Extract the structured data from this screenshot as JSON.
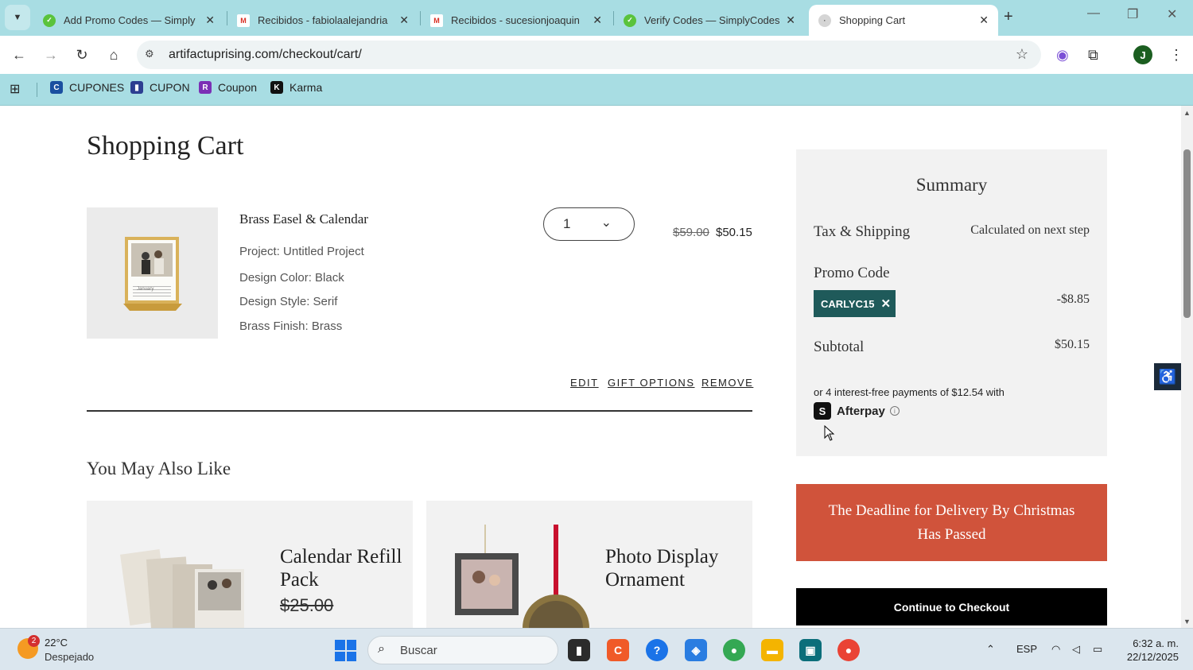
{
  "browser": {
    "tabs": [
      {
        "title": "Add Promo Codes — Simply",
        "active": false
      },
      {
        "title": "Recibidos - fabiolaalejandria",
        "active": false
      },
      {
        "title": "Recibidos - sucesionjoaquin",
        "active": false
      },
      {
        "title": "Verify Codes — SimplyCodes",
        "active": false
      },
      {
        "title": "Shopping Cart",
        "active": true
      }
    ],
    "url": "artifactuprising.com/checkout/cart/",
    "bookmarks": [
      {
        "label": "CUPONES",
        "icon": "cupones-icon"
      },
      {
        "label": "CUPON",
        "icon": "cupon-icon"
      },
      {
        "label": "Coupon",
        "icon": "coupon-icon"
      },
      {
        "label": "Karma",
        "icon": "karma-icon"
      }
    ],
    "profile_initial": "J"
  },
  "cart": {
    "title": "Shopping Cart",
    "item": {
      "name": "Brass Easel & Calendar",
      "project": "Project: Untitled Project",
      "design_color": "Design Color: Black",
      "design_style": "Design Style: Serif",
      "brass_finish": "Brass Finish: Brass",
      "quantity": "1",
      "price_original": "$59.00",
      "price_current": "$50.15",
      "image_caption": "January"
    },
    "actions": {
      "edit": "EDIT",
      "gift": "GIFT OPTIONS",
      "remove": "REMOVE"
    }
  },
  "recommendations": {
    "title": "You May Also Like",
    "items": [
      {
        "name": "Calendar Refill Pack",
        "price": "$25.00"
      },
      {
        "name": "Photo Display Ornament",
        "price": ""
      }
    ]
  },
  "summary": {
    "title": "Summary",
    "tax_label": "Tax & Shipping",
    "tax_value": "Calculated on next step",
    "promo_label": "Promo Code",
    "promo_code": "CARLYC15",
    "promo_discount": "-$8.85",
    "subtotal_label": "Subtotal",
    "subtotal_value": "$50.15",
    "afterpay_text": "or 4 interest-free payments of $12.54 with",
    "afterpay_brand": "Afterpay"
  },
  "deadline_notice": "The Deadline for Delivery By Christmas Has Passed",
  "checkout_label": "Continue to Checkout",
  "taskbar": {
    "weather_temp": "22°C",
    "weather_desc": "Despejado",
    "weather_badge": "2",
    "search_placeholder": "Buscar",
    "language": "ESP",
    "time": "6:32 a. m.",
    "date": "22/12/2025"
  },
  "colors": {
    "chrome_accent": "#a8dde3",
    "promo_chip": "#1f5a5a",
    "deadline_bg": "#d0533b",
    "checkout_bg": "#000000"
  }
}
